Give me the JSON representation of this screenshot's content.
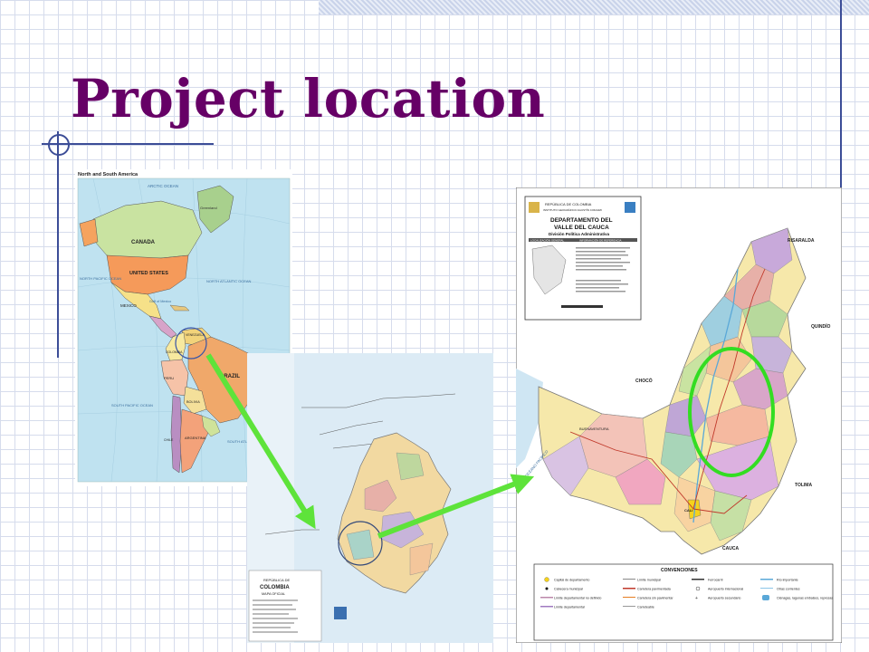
{
  "slide": {
    "title": "Project location"
  },
  "americas_map": {
    "title": "North and South America",
    "labels": {
      "canada": "CANADA",
      "united_states": "UNITED STATES",
      "mexico": "MEXICO",
      "colombia": "COLOMBIA",
      "venezuela": "VENEZUELA",
      "brazil": "BRAZIL",
      "peru": "PERU",
      "bolivia": "BOLIVIA",
      "argentina": "ARGENTINA",
      "chile": "CHILE",
      "greenland": "Greenland",
      "arctic_ocean": "ARCTIC OCEAN",
      "north_pacific": "NORTH PACIFIC OCEAN",
      "north_atlantic": "NORTH ATLANTIC OCEAN",
      "south_pacific": "SOUTH PACIFIC OCEAN",
      "south_atlantic": "SOUTH ATLANTIC OCEAN",
      "gulf_of_mexico": "Gulf of Mexico"
    }
  },
  "colombia_map": {
    "labels": {
      "country": "COLOMBIA",
      "subtitle": "MAPA OFICIAL",
      "republica": "REPÚBLICA DE"
    }
  },
  "cauca_map": {
    "header": {
      "republic": "REPÚBLICA DE COLOMBIA",
      "institute": "INSTITUTO GEOGRÁFICO AGUSTÍN CODAZZI",
      "title_line1": "DEPARTAMENTO DEL",
      "title_line2": "VALLE DEL CAUCA",
      "subtitle": "División Política Administrativa",
      "loc_general": "LOCALIZACIÓN GENERAL",
      "info_ref": "INFORMACIÓN DE REFERENCIA"
    },
    "labels": {
      "risaralda": "RISARALDA",
      "quindio": "QUINDÍO",
      "choco": "CHOCÓ",
      "tolima": "TOLIMA",
      "cauca": "CAUCA",
      "buenaventura": "BUENAVENTURA",
      "cali": "CALI",
      "oceano": "OCÉANO PACÍFICO"
    },
    "legend": {
      "title": "CONVENCIONES",
      "items": [
        "Capital de departamento",
        "Cabecera municipal",
        "Límite departamental no definido",
        "Límite departamental",
        "Límite municipal",
        "Carretera pavimentada",
        "Carretera sin pavimentar",
        "Carreteable",
        "Ferrocarril",
        "Aeropuerto internacional",
        "Aeropuerto secundario",
        "Río importante",
        "Otras corrientes",
        "Ciénagas, lagunas embalses, represas"
      ]
    }
  },
  "colors": {
    "title": "#660066",
    "arrow": "#5ee33a",
    "highlight_ellipse": "#33dd22",
    "grid": "#d6dcec",
    "rule": "#3c4d97"
  }
}
